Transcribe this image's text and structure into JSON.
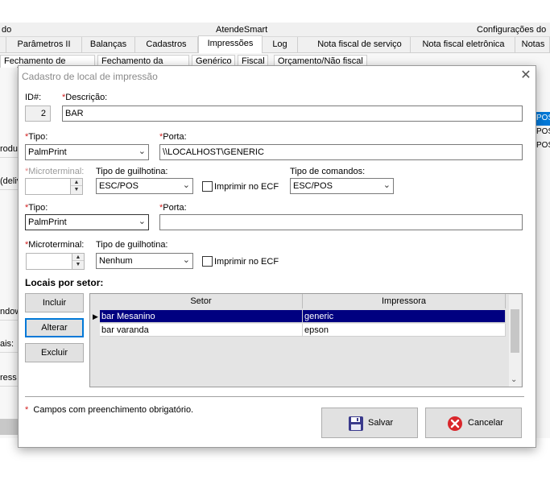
{
  "app": {
    "header": {
      "left": "do",
      "center": "AtendeSmart",
      "right": "Configurações do e"
    },
    "tabs": [
      "Parâmetros II",
      "Balanças",
      "Cadastros",
      "Impressões",
      "Log",
      "Nota fiscal de serviço",
      "Nota fiscal eletrônica",
      "Notas"
    ],
    "active_tab": "Impressões",
    "subtabs": [
      "Fechamento de pedido",
      "Fechamento da mesa",
      "Genérico",
      "Fiscal",
      "Orçamento/Não fiscal"
    ],
    "left_rows": [
      "rodu",
      "(deliv",
      "ndow",
      "ais:",
      "ress"
    ],
    "right_rows": [
      "POS",
      "POS",
      "POS"
    ]
  },
  "dialog": {
    "title": "Cadastro de local de impressão",
    "close_glyph": "✕",
    "id_label": "ID#:",
    "id_value": "2",
    "descricao_label": "Descrição:",
    "descricao_value": "BAR",
    "printer1": {
      "tipo_label": "Tipo:",
      "tipo_value": "PalmPrint",
      "porta_label": "Porta:",
      "porta_value": "\\\\LOCALHOST\\GENERIC",
      "microterminal_label": "Microterminal:",
      "guilhotina_label": "Tipo de guilhotina:",
      "guilhotina_value": "ESC/POS",
      "imprimir_ecf_label": "Imprimir no ECF",
      "comandos_label": "Tipo de comandos:",
      "comandos_value": "ESC/POS"
    },
    "printer2": {
      "tipo_label": "Tipo:",
      "tipo_value": "PalmPrint",
      "porta_label": "Porta:",
      "porta_value": "",
      "microterminal_label": "Microterminal:",
      "guilhotina_label": "Tipo de guilhotina:",
      "guilhotina_value": "Nenhum",
      "imprimir_ecf_label": "Imprimir no ECF"
    },
    "locais_title": "Locais por setor:",
    "buttons": {
      "incluir": "Incluir",
      "alterar": "Alterar",
      "excluir": "Excluir"
    },
    "grid": {
      "columns": [
        "Setor",
        "Impressora"
      ],
      "rows": [
        {
          "setor": "bar Mesanino",
          "impressora": "generic",
          "selected": true
        },
        {
          "setor": "bar varanda",
          "impressora": "epson",
          "selected": false
        }
      ]
    },
    "required_asterisk": "*",
    "footnote": "Campos com preenchimento obrigatório.",
    "salvar_label": "Salvar",
    "cancelar_label": "Cancelar"
  },
  "colors": {
    "selection": "#000080",
    "required": "#d21e1e",
    "focus": "#0078d7",
    "cancel_icon": "#d9262b",
    "save_icon": "#3a3a8c"
  },
  "icons": [
    "chevron-down-icon",
    "close-icon",
    "save-disk-icon",
    "cancel-x-icon",
    "row-pointer-icon"
  ]
}
